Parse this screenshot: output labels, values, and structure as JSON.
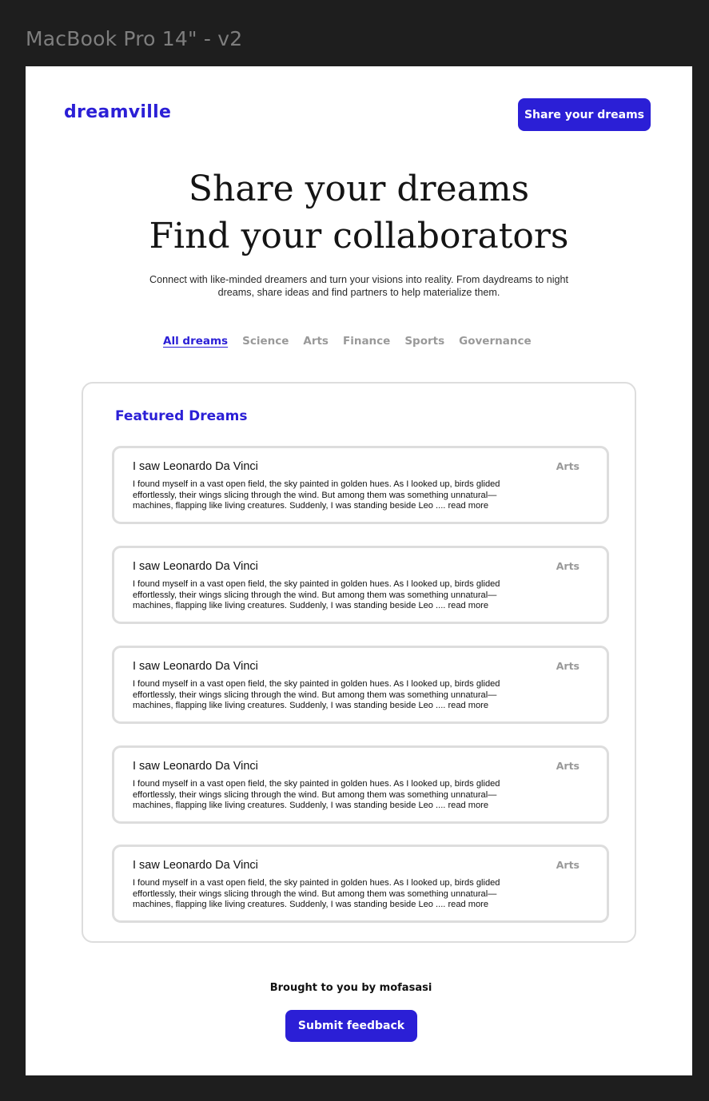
{
  "canvas": {
    "frame_label": "MacBook Pro 14\" - v2"
  },
  "header": {
    "brand": "dreamville",
    "share_button_label": "Share your dreams"
  },
  "hero": {
    "title_line_1": "Share your dreams",
    "title_line_2": "Find your collaborators",
    "subtitle": "Connect with like-minded dreamers and turn your visions into reality. From daydreams to night dreams, share ideas and find partners to help materialize them."
  },
  "tabs": [
    {
      "label": "All dreams",
      "active": true
    },
    {
      "label": "Science",
      "active": false
    },
    {
      "label": "Arts",
      "active": false
    },
    {
      "label": "Finance",
      "active": false
    },
    {
      "label": "Sports",
      "active": false
    },
    {
      "label": "Governance",
      "active": false
    }
  ],
  "featured": {
    "heading": "Featured Dreams",
    "cards": [
      {
        "title": "I saw Leonardo Da Vinci",
        "category": "Arts",
        "body": "I found myself in a vast open field, the sky painted in golden hues. As I looked up, birds glided\neffortlessly, their wings slicing through the wind. But among them was something unnatural—\nmachines, flapping like living creatures. Suddenly, I was standing beside Leo .... read more"
      },
      {
        "title": "I saw Leonardo Da Vinci",
        "category": "Arts",
        "body": "I found myself in a vast open field, the sky painted in golden hues. As I looked up, birds glided\neffortlessly, their wings slicing through the wind. But among them was something unnatural—\nmachines, flapping like living creatures. Suddenly, I was standing beside Leo .... read more"
      },
      {
        "title": "I saw Leonardo Da Vinci",
        "category": "Arts",
        "body": "I found myself in a vast open field, the sky painted in golden hues. As I looked up, birds glided\neffortlessly, their wings slicing through the wind. But among them was something unnatural—\nmachines, flapping like living creatures. Suddenly, I was standing beside Leo .... read more"
      },
      {
        "title": "I saw Leonardo Da Vinci",
        "category": "Arts",
        "body": "I found myself in a vast open field, the sky painted in golden hues. As I looked up, birds glided\neffortlessly, their wings slicing through the wind. But among them was something unnatural—\nmachines, flapping like living creatures. Suddenly, I was standing beside Leo .... read more"
      },
      {
        "title": "I saw Leonardo Da Vinci",
        "category": "Arts",
        "body": "I found myself in a vast open field, the sky painted in golden hues. As I looked up, birds glided\neffortlessly, their wings slicing through the wind. But among them was something unnatural—\nmachines, flapping like living creatures. Suddenly, I was standing beside Leo .... read more"
      }
    ]
  },
  "footer": {
    "credit": "Brought to you by mofasasi",
    "feedback_button_label": "Submit feedback"
  },
  "colors": {
    "accent": "#2b1fd6",
    "muted_text": "#999999",
    "card_border": "#dddddd",
    "canvas_background": "#1e1e1e"
  }
}
